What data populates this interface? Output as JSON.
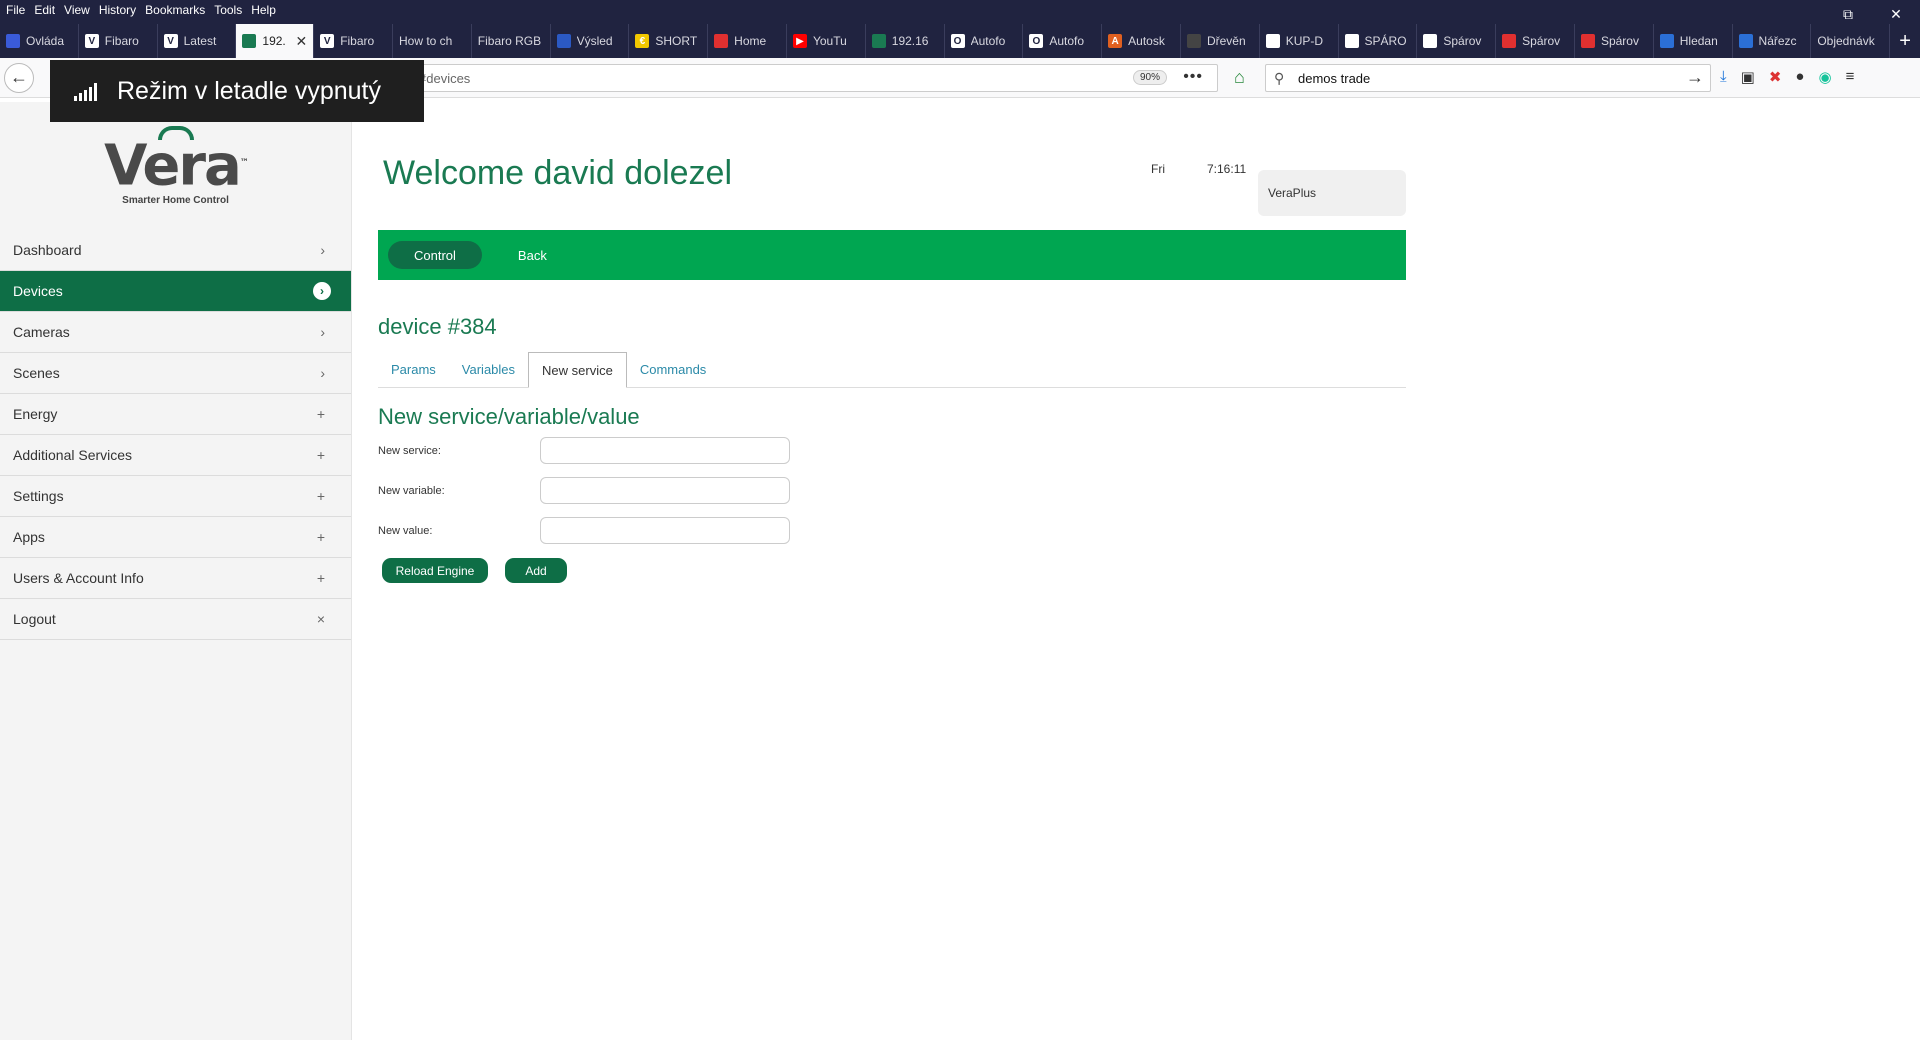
{
  "browser": {
    "menu": [
      "File",
      "Edit",
      "View",
      "History",
      "Bookmarks",
      "Tools",
      "Help"
    ],
    "window_controls": [
      "⧉",
      "✕"
    ],
    "tabs": [
      {
        "label": "Ovláda",
        "fav_color": "#3a5bd9",
        "fav_text": ""
      },
      {
        "label": "Fibaro",
        "fav_color": "#ffffff",
        "fav_text": "V"
      },
      {
        "label": "Latest",
        "fav_color": "#ffffff",
        "fav_text": "V"
      },
      {
        "label": "192.",
        "fav_color": "#1a7a52",
        "fav_text": ""
      },
      {
        "label": "Fibaro",
        "fav_color": "#ffffff",
        "fav_text": "V"
      },
      {
        "label": "How to ch",
        "fav_color": "",
        "fav_text": ""
      },
      {
        "label": "Fibaro RGB",
        "fav_color": "",
        "fav_text": ""
      },
      {
        "label": "Výsled",
        "fav_color": "#2b59c3",
        "fav_text": ""
      },
      {
        "label": "SHORT",
        "fav_color": "#f2c800",
        "fav_text": "€"
      },
      {
        "label": "Home",
        "fav_color": "#e03030",
        "fav_text": ""
      },
      {
        "label": "YouTu",
        "fav_color": "#ff0000",
        "fav_text": "▶"
      },
      {
        "label": "192.16",
        "fav_color": "#1a7a52",
        "fav_text": ""
      },
      {
        "label": "Autofo",
        "fav_color": "#ffffff",
        "fav_text": "O"
      },
      {
        "label": "Autofo",
        "fav_color": "#ffffff",
        "fav_text": "O"
      },
      {
        "label": "Autosk",
        "fav_color": "#e06020",
        "fav_text": "A"
      },
      {
        "label": "Dřevěn",
        "fav_color": "#444444",
        "fav_text": ""
      },
      {
        "label": "KUP-D",
        "fav_color": "#ffffff",
        "fav_text": ""
      },
      {
        "label": "SPÁRO",
        "fav_color": "#ffffff",
        "fav_text": ""
      },
      {
        "label": "Spárov",
        "fav_color": "#ffffff",
        "fav_text": ""
      },
      {
        "label": "Spárov",
        "fav_color": "#e03030",
        "fav_text": ""
      },
      {
        "label": "Spárov",
        "fav_color": "#e03030",
        "fav_text": ""
      },
      {
        "label": "Hledan",
        "fav_color": "#2b6fd6",
        "fav_text": ""
      },
      {
        "label": "Nářezc",
        "fav_color": "#2b6fd6",
        "fav_text": ""
      },
      {
        "label": "Objednávk",
        "fav_color": "",
        "fav_text": ""
      }
    ],
    "active_tab_index": 3,
    "url_suffix": "#devices",
    "zoom": "90%",
    "search_value": "demos trade",
    "new_tab": "+",
    "more": "•••"
  },
  "overlay": {
    "text": "Režim v letadle vypnutý"
  },
  "logo": {
    "word": "Vera",
    "tm": "™",
    "tagline": "Smarter Home Control"
  },
  "sidebar": {
    "items": [
      {
        "label": "Dashboard",
        "icon": "›"
      },
      {
        "label": "Devices",
        "icon": "›"
      },
      {
        "label": "Cameras",
        "icon": "›"
      },
      {
        "label": "Scenes",
        "icon": "›"
      },
      {
        "label": "Energy",
        "icon": "+"
      },
      {
        "label": "Additional Services",
        "icon": "+"
      },
      {
        "label": "Settings",
        "icon": "+"
      },
      {
        "label": "Apps",
        "icon": "+"
      },
      {
        "label": "Users & Account Info",
        "icon": "+"
      },
      {
        "label": "Logout",
        "icon": "×"
      }
    ]
  },
  "header": {
    "welcome": "Welcome david dolezel",
    "day": "Fri",
    "time": "7:16:11",
    "unit": "VeraPlus"
  },
  "toolbar": {
    "control": "Control",
    "back": "Back"
  },
  "device": {
    "title": "device #384",
    "tabs": [
      "Params",
      "Variables",
      "New service",
      "Commands"
    ],
    "active_tab": 2
  },
  "form": {
    "title": "New service/variable/value",
    "service_label": "New service:",
    "variable_label": "New variable:",
    "value_label": "New value:",
    "service_value": "",
    "variable_value": "",
    "value_value": "",
    "reload_label": "Reload Engine",
    "add_label": "Add"
  },
  "colors": {
    "brand_green": "#00a651",
    "dark_green": "#0e6e46",
    "title_green": "#1a7a52",
    "browser_dark": "#202340"
  }
}
